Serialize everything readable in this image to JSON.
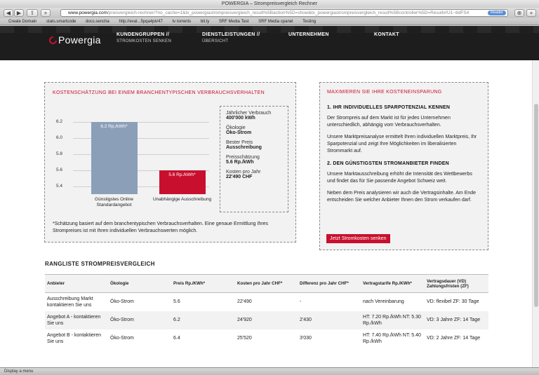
{
  "window": {
    "title": "POWERGIA – Strompreisvergleich Rechner"
  },
  "toolbar": {
    "back": "◀",
    "forward": "▶",
    "share": "⇪",
    "add_tab": "+",
    "url_host": "www.powergia.com",
    "url_rest": "/preisvergleich-rechner/?no_cache=1&tx_powergiastrompreisvergleich_result%5Baction%5D=show&tx_powergiastrompreisvergleich_result%5Bcontroller%5D=Result#/U1~8dFS4",
    "reader": "Reader"
  },
  "bookmarks": [
    "Create Domain",
    "stats.smartcode",
    "docs.sencha",
    "http://eval...5pqa4pk/47",
    "tv torrents",
    "bit.ly",
    "SRF Media Test",
    "SRF Media cpanel",
    "Testing"
  ],
  "site": {
    "logo": "Powergia",
    "nav": [
      {
        "main": "KUNDENGRUPPEN //",
        "sub": "STROMKOSTEN SENKEN"
      },
      {
        "main": "DIENSTLEISTUNGEN //",
        "sub": "ÜBERSICHT"
      },
      {
        "main": "UNTERNEHMEN",
        "sub": ""
      },
      {
        "main": "KONTAKT",
        "sub": ""
      }
    ]
  },
  "estimate": {
    "heading": "KOSTENSCHÄTZUNG BEI EINEM BRANCHENTYPISCHEN VERBRAUCHSVERHALTEN",
    "note": "*Schätzung basiert auf dem branchentypischen Verbrauchsverhalten. Eine genaue Ermittlung Ihres Strompreises ist mit Ihren individuellen Verbrauchswerten möglich.",
    "summary": [
      {
        "label": "Jährlicher Verbrauch",
        "value": "400'000 kWh"
      },
      {
        "label": "Ökologie",
        "value": "Öko-Strom"
      },
      {
        "label": "Bester Preis",
        "value": "Ausschreibung"
      },
      {
        "label": "Preisschätzung",
        "value": "5.6 Rp./kWh"
      },
      {
        "label": "Kosten pro Jahr",
        "value": "22'490 CHF"
      }
    ]
  },
  "chart_data": {
    "type": "bar",
    "categories": [
      "Günstigstes Online Standardangebot",
      "Unabhängige Ausschreibung"
    ],
    "values": [
      6.2,
      5.6
    ],
    "data_labels": [
      "6.2 Rp./kWh*",
      "5.6 Rp./kWh*"
    ],
    "colors": [
      "#8c9fb8",
      "#c8102e"
    ],
    "yticks": [
      "6.2",
      "6.0",
      "5.8",
      "5.6",
      "5.4"
    ],
    "ylim": [
      5.3,
      6.25
    ],
    "grid": true,
    "title": "",
    "xlabel": "",
    "ylabel": ""
  },
  "savings": {
    "heading": "MAXIMIEREN SIE IHRE KOSTENEINSPARUNG",
    "h1": "1. IHR INDIVIDUELLES SPARPOTENZIAL KENNEN",
    "p1": "Der Strompreis auf dem Markt ist für jedes Unternehmen unterschiedlich, abhängig vom Verbrauchsverhalten.",
    "p2": "Unsere Marktpreisanalyse ermittelt Ihren individuellen Marktpreis, Ihr Sparpotenzial und zeigt Ihre Möglichkeiten im liberalisierten Strommarkt auf.",
    "h2": "2. DEN GÜNSTIGSTEN STROMANBIETER FINDEN",
    "p3": "Unsere Marktausschreibung erhöht die Intensität des Wettbewerbs und findet das für Sie passende Angebot Schweiz weit.",
    "p4": "Neben dem Preis analysieren wir auch die Vertragsinhalte. Am Ende entscheiden Sie welcher Anbieter Ihnen den Strom verkaufen darf.",
    "cta": "Jetzt Stromkosten senken"
  },
  "ranking": {
    "title": "RANGLISTE STROMPREISVERGLEICH",
    "headers": [
      "Anbieter",
      "Ökologie",
      "Preis Rp./KWh*",
      "Kosten pro Jahr CHF*",
      "Differenz pro Jahr CHF*",
      "Vertragstarife Rp./KWh*",
      "Vertragsdauer (VD) Zahlungsfristen (ZF)"
    ],
    "rows": [
      [
        "Ausschreibung Markt kontaktieren Sie uns",
        "Öko-Strom",
        "5.6",
        "22'490",
        "-",
        "nach Vereinbarung",
        "VD: flexibel ZF: 30 Tage"
      ],
      [
        "Angebot A - kontaktieren Sie uns",
        "Öko-Strom",
        "6.2",
        "24'920",
        "2'430",
        "HT: 7.20 Rp./kWh NT: 5.30 Rp./kWh",
        "VD: 3 Jahre ZF: 14 Tage"
      ],
      [
        "Angebot B - kontaktieren Sie uns",
        "Öko-Strom",
        "6.4",
        "25'520",
        "3'030",
        "HT: 7.40 Rp./kWh NT: 5.40 Rp./kWh",
        "VD: 2 Jahre ZF: 14 Tage"
      ]
    ]
  },
  "status": "Display a menu"
}
